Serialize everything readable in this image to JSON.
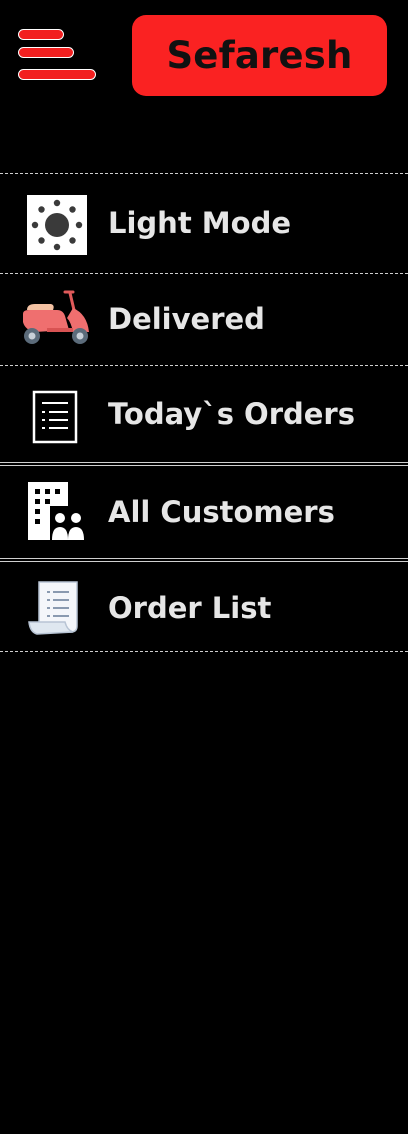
{
  "header": {
    "menu_icon": "hamburger-menu-icon",
    "brand_label": "Sefaresh",
    "brand_color": "#fa2222",
    "hamburger_color": "#f21f1f"
  },
  "menu": {
    "items": [
      {
        "label": "Light Mode",
        "icon": "sun-icon"
      },
      {
        "label": "Delivered",
        "icon": "scooter-icon"
      },
      {
        "label": "Today`s Orders",
        "icon": "document-list-icon"
      },
      {
        "label": "All Customers",
        "icon": "customers-icon"
      },
      {
        "label": "Order List",
        "icon": "receipt-icon"
      }
    ]
  },
  "colors": {
    "background": "#000000",
    "text": "#e6e6e6",
    "divider": "#cfcfcf"
  }
}
